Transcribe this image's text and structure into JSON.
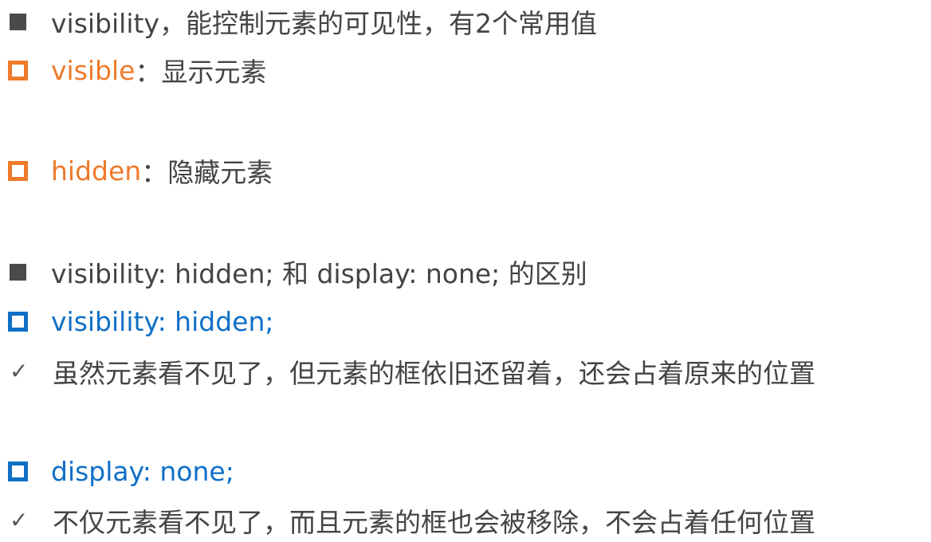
{
  "colors": {
    "dark_text": "#444444",
    "orange": "#ee7a2a",
    "blue": "#0f6fc6",
    "bullet_filled": "#4a4a4a"
  },
  "lines": [
    {
      "marker": "filled-square-bullet",
      "keyword": "",
      "text": "visibility，能控制元素的可见性，有2个常用值"
    },
    {
      "marker": "hollow-square-bullet-orange",
      "keyword": "visible",
      "text": "：显示元素"
    },
    {
      "marker": "hollow-square-bullet-orange",
      "keyword": "hidden",
      "text": "：隐藏元素"
    },
    {
      "marker": "filled-square-bullet",
      "keyword": "",
      "text": "visibility: hidden; 和 display: none; 的区别"
    },
    {
      "marker": "hollow-square-bullet-blue",
      "keyword": "visibility: hidden;",
      "text": ""
    },
    {
      "marker": "check-icon",
      "keyword": "",
      "text": "虽然元素看不见了，但元素的框依旧还留着，还会占着原来的位置"
    },
    {
      "marker": "hollow-square-bullet-blue",
      "keyword": "display: none;",
      "text": ""
    },
    {
      "marker": "check-icon",
      "keyword": "",
      "text": "不仅元素看不见了，而且元素的框也会被移除，不会占着任何位置"
    }
  ],
  "check_glyph": "✓"
}
